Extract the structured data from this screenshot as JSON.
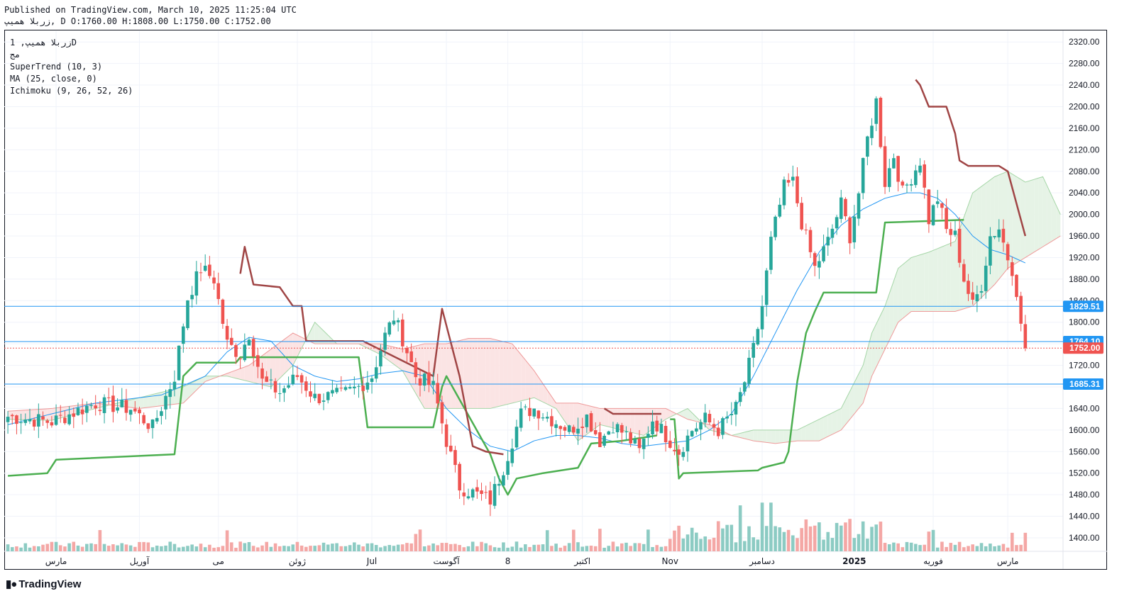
{
  "header": {
    "published": "Published on TradingView.com, March 10, 2025 11:25:04 UTC",
    "ohlc": "زربلا همیپ, D O:1760.00 H:1808.00 L:1750.00 C:1752.00"
  },
  "legend": {
    "symbol": "زربلا همیپ, 1D",
    "line2": "مج",
    "supertrend": "SuperTrend (10, 3)",
    "ma": "MA (25, close, 0)",
    "ichimoku": "Ichimoku (9, 26, 52, 26)"
  },
  "footer": {
    "logo_text": "TradingView",
    "logo_icon": "tradingview-logo-icon"
  },
  "colors": {
    "up": "#26a69a",
    "down": "#ef5350",
    "supertrend_up": "#4caf50",
    "supertrend_down": "#a04545",
    "ma": "#2196f3",
    "cloud_green": "#e6f3e6",
    "cloud_red": "#fbe4e4",
    "hline": "#2196f3"
  },
  "chart_data": {
    "type": "candlestick",
    "y_axis": {
      "range": [
        1375,
        2340
      ],
      "ticks": [
        "2320.00",
        "2280.00",
        "2240.00",
        "2200.00",
        "2160.00",
        "2120.00",
        "2080.00",
        "2040.00",
        "2000.00",
        "1960.00",
        "1920.00",
        "1880.00",
        "1840.00",
        "1800.00",
        "1760.00",
        "1720.00",
        "1680.00",
        "1640.00",
        "1600.00",
        "1560.00",
        "1520.00",
        "1480.00",
        "1440.00",
        "1400.00"
      ]
    },
    "x_axis": {
      "bars": 240,
      "labels": [
        {
          "bar": 11,
          "text": "مارس"
        },
        {
          "bar": 30,
          "text": "آوریل"
        },
        {
          "bar": 48,
          "text": "می"
        },
        {
          "bar": 66,
          "text": "ژوئن"
        },
        {
          "bar": 83,
          "text": "Jul"
        },
        {
          "bar": 100,
          "text": "آگوست"
        },
        {
          "bar": 114,
          "text": "8"
        },
        {
          "bar": 131,
          "text": "اکتبر"
        },
        {
          "bar": 151,
          "text": "Nov"
        },
        {
          "bar": 172,
          "text": "دسامبر"
        },
        {
          "bar": 193,
          "text": "2025"
        },
        {
          "bar": 211,
          "text": "فوریه"
        },
        {
          "bar": 228,
          "text": "مارس"
        }
      ]
    },
    "price_labels": [
      {
        "value": 1829.51,
        "text": "1829.51",
        "color": "#2196f3"
      },
      {
        "value": 1764.1,
        "text": "1764.10",
        "color": "#2196f3"
      },
      {
        "value": 1752.0,
        "text": "1752.00",
        "color": "#ef5350"
      },
      {
        "value": 1685.31,
        "text": "1685.31",
        "color": "#2196f3"
      }
    ],
    "horizontal_lines": [
      1829.51,
      1764.1,
      1685.31
    ],
    "last_close": 1752.0,
    "price_anchors": [
      [
        0,
        1625
      ],
      [
        10,
        1615
      ],
      [
        20,
        1650
      ],
      [
        28,
        1640
      ],
      [
        33,
        1605
      ],
      [
        38,
        1700
      ],
      [
        41,
        1845
      ],
      [
        44,
        1900
      ],
      [
        47,
        1880
      ],
      [
        50,
        1760
      ],
      [
        53,
        1740
      ],
      [
        55,
        1780
      ],
      [
        58,
        1690
      ],
      [
        62,
        1670
      ],
      [
        66,
        1700
      ],
      [
        70,
        1660
      ],
      [
        76,
        1665
      ],
      [
        80,
        1680
      ],
      [
        83,
        1700
      ],
      [
        86,
        1775
      ],
      [
        88,
        1810
      ],
      [
        90,
        1770
      ],
      [
        93,
        1700
      ],
      [
        97,
        1680
      ],
      [
        100,
        1580
      ],
      [
        103,
        1495
      ],
      [
        107,
        1480
      ],
      [
        110,
        1470
      ],
      [
        113,
        1530
      ],
      [
        117,
        1630
      ],
      [
        120,
        1640
      ],
      [
        124,
        1620
      ],
      [
        128,
        1600
      ],
      [
        132,
        1625
      ],
      [
        135,
        1580
      ],
      [
        138,
        1610
      ],
      [
        141,
        1590
      ],
      [
        144,
        1560
      ],
      [
        147,
        1620
      ],
      [
        150,
        1590
      ],
      [
        153,
        1560
      ],
      [
        156,
        1600
      ],
      [
        159,
        1620
      ],
      [
        162,
        1600
      ],
      [
        166,
        1640
      ],
      [
        168,
        1690
      ],
      [
        170,
        1750
      ],
      [
        172,
        1830
      ],
      [
        174,
        1950
      ],
      [
        177,
        2050
      ],
      [
        179,
        2060
      ],
      [
        181,
        1985
      ],
      [
        184,
        1900
      ],
      [
        187,
        1950
      ],
      [
        190,
        2020
      ],
      [
        192,
        1960
      ],
      [
        194,
        2040
      ],
      [
        196,
        2140
      ],
      [
        198,
        2210
      ],
      [
        200,
        2060
      ],
      [
        202,
        2110
      ],
      [
        204,
        2040
      ],
      [
        206,
        2070
      ],
      [
        208,
        2100
      ],
      [
        210,
        1990
      ],
      [
        212,
        2030
      ],
      [
        214,
        1970
      ],
      [
        216,
        1960
      ],
      [
        218,
        1880
      ],
      [
        220,
        1830
      ],
      [
        222,
        1870
      ],
      [
        224,
        1960
      ],
      [
        226,
        1975
      ],
      [
        228,
        1920
      ],
      [
        229,
        1900
      ],
      [
        230,
        1860
      ],
      [
        231,
        1790
      ],
      [
        232,
        1752
      ]
    ],
    "ma_anchors": [
      [
        0,
        1610
      ],
      [
        20,
        1650
      ],
      [
        35,
        1665
      ],
      [
        45,
        1700
      ],
      [
        50,
        1745
      ],
      [
        55,
        1772
      ],
      [
        60,
        1765
      ],
      [
        65,
        1720
      ],
      [
        70,
        1700
      ],
      [
        75,
        1690
      ],
      [
        80,
        1695
      ],
      [
        85,
        1705
      ],
      [
        90,
        1710
      ],
      [
        95,
        1700
      ],
      [
        100,
        1640
      ],
      [
        105,
        1600
      ],
      [
        110,
        1570
      ],
      [
        115,
        1560
      ],
      [
        120,
        1580
      ],
      [
        125,
        1590
      ],
      [
        130,
        1590
      ],
      [
        135,
        1585
      ],
      [
        140,
        1575
      ],
      [
        145,
        1570
      ],
      [
        150,
        1575
      ],
      [
        155,
        1580
      ],
      [
        160,
        1600
      ],
      [
        165,
        1630
      ],
      [
        170,
        1700
      ],
      [
        175,
        1780
      ],
      [
        180,
        1860
      ],
      [
        185,
        1930
      ],
      [
        190,
        1980
      ],
      [
        195,
        2010
      ],
      [
        200,
        2030
      ],
      [
        205,
        2040
      ],
      [
        208,
        2040
      ],
      [
        212,
        2030
      ],
      [
        216,
        2000
      ],
      [
        220,
        1960
      ],
      [
        224,
        1935
      ],
      [
        228,
        1925
      ],
      [
        232,
        1910
      ]
    ],
    "supertrend_up": [
      [
        0,
        1515
      ],
      [
        9,
        1520
      ],
      [
        11,
        1545
      ],
      [
        38,
        1555
      ],
      [
        40,
        1700
      ],
      [
        43,
        1725
      ],
      [
        52,
        1725
      ],
      [
        53,
        1735
      ],
      [
        80,
        1735
      ],
      [
        81,
        1670
      ],
      [
        82,
        1605
      ],
      [
        97,
        1605
      ],
      [
        99,
        1680
      ],
      [
        100,
        1700
      ],
      [
        110,
        1555
      ],
      [
        112,
        1510
      ],
      [
        114,
        1480
      ],
      [
        116,
        1510
      ],
      [
        122,
        1520
      ],
      [
        130,
        1530
      ],
      [
        133,
        1575
      ],
      [
        140,
        1580
      ],
      [
        148,
        1590
      ],
      [
        148,
        1590
      ],
      null,
      [
        151,
        1620
      ],
      [
        152,
        1620
      ],
      [
        153,
        1510
      ],
      [
        154,
        1520
      ],
      [
        171,
        1525
      ],
      [
        172,
        1530
      ],
      [
        177,
        1540
      ],
      [
        178,
        1560
      ],
      [
        180,
        1690
      ],
      [
        182,
        1780
      ],
      [
        184,
        1820
      ],
      [
        186,
        1855
      ],
      [
        198,
        1855
      ],
      [
        200,
        1985
      ],
      [
        218,
        1990
      ]
    ],
    "supertrend_down": [
      [
        53,
        1890
      ],
      [
        54,
        1940
      ],
      [
        56,
        1870
      ],
      [
        62,
        1865
      ],
      [
        65,
        1830
      ],
      [
        67,
        1830
      ],
      [
        68,
        1765
      ],
      [
        81,
        1765
      ],
      [
        97,
        1700
      ],
      [
        99,
        1825
      ],
      [
        103,
        1700
      ],
      [
        106,
        1570
      ],
      [
        109,
        1560
      ],
      [
        113,
        1555
      ],
      [
        113,
        1555
      ],
      null,
      [
        136,
        1640
      ],
      [
        138,
        1630
      ],
      [
        149,
        1630
      ],
      [
        149,
        1630
      ],
      null,
      [
        207,
        2250
      ],
      [
        208,
        2240
      ],
      [
        210,
        2200
      ],
      [
        214,
        2200
      ],
      [
        216,
        2150
      ],
      [
        217,
        2100
      ],
      [
        219,
        2090
      ],
      [
        226,
        2090
      ],
      [
        228,
        2080
      ],
      [
        232,
        1960
      ]
    ],
    "cloud_anchors": [
      [
        0,
        1620,
        1635
      ],
      [
        10,
        1618,
        1640
      ],
      [
        20,
        1640,
        1650
      ],
      [
        30,
        1660,
        1640
      ],
      [
        40,
        1680,
        1650
      ],
      [
        45,
        1700,
        1690
      ],
      [
        50,
        1700,
        1705
      ],
      [
        55,
        1690,
        1720
      ],
      [
        60,
        1680,
        1750
      ],
      [
        65,
        1720,
        1780
      ],
      [
        70,
        1800,
        1760
      ],
      [
        75,
        1760,
        1760
      ],
      [
        80,
        1760,
        1760
      ],
      [
        85,
        1740,
        1760
      ],
      [
        90,
        1710,
        1750
      ],
      [
        95,
        1640,
        1760
      ],
      [
        100,
        1640,
        1760
      ],
      [
        105,
        1640,
        1770
      ],
      [
        110,
        1640,
        1770
      ],
      [
        115,
        1650,
        1760
      ],
      [
        120,
        1660,
        1710
      ],
      [
        125,
        1640,
        1650
      ],
      [
        130,
        1580,
        1650
      ],
      [
        135,
        1610,
        1640
      ],
      [
        140,
        1600,
        1640
      ],
      [
        145,
        1590,
        1640
      ],
      [
        150,
        1620,
        1640
      ],
      [
        155,
        1640,
        1620
      ],
      [
        160,
        1600,
        1610
      ],
      [
        165,
        1590,
        1590
      ],
      [
        170,
        1600,
        1580
      ],
      [
        175,
        1600,
        1575
      ],
      [
        180,
        1600,
        1580
      ],
      [
        185,
        1620,
        1580
      ],
      [
        190,
        1640,
        1600
      ],
      [
        195,
        1720,
        1650
      ],
      [
        197,
        1780,
        1700
      ],
      [
        200,
        1830,
        1750
      ],
      [
        203,
        1900,
        1800
      ],
      [
        206,
        1920,
        1820
      ],
      [
        210,
        1930,
        1820
      ],
      [
        213,
        1940,
        1820
      ],
      [
        216,
        1950,
        1820
      ],
      [
        220,
        2040,
        1830
      ],
      [
        225,
        2070,
        1870
      ],
      [
        228,
        2080,
        1900
      ],
      [
        232,
        2060,
        1920
      ],
      [
        236,
        2070,
        1940
      ],
      [
        240,
        2000,
        1960
      ]
    ],
    "volume_range": [
      0,
      120
    ]
  }
}
